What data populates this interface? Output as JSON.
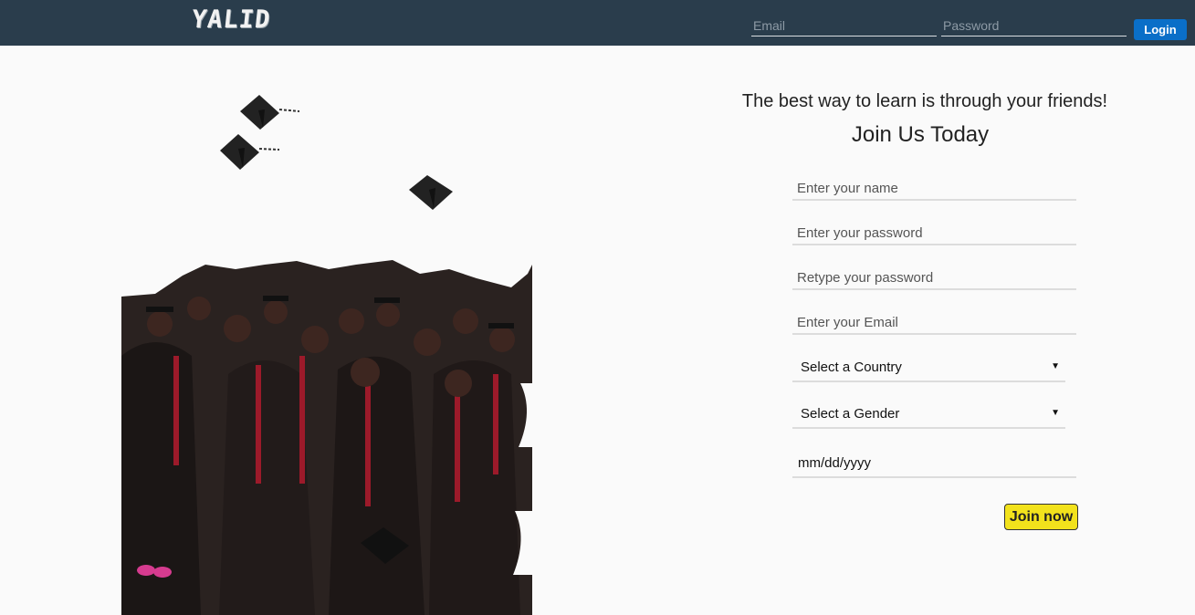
{
  "header": {
    "logo": "YALID",
    "email_placeholder": "Email",
    "password_placeholder": "Password",
    "login_label": "Login"
  },
  "signup": {
    "tagline": "The best way to learn is through your friends!",
    "heading": "Join Us Today",
    "name_placeholder": "Enter your name",
    "password_placeholder": "Enter your password",
    "retype_placeholder": "Retype your password",
    "email_placeholder": "Enter your Email",
    "country_selected": "Select a Country",
    "gender_selected": "Select a Gender",
    "date_placeholder": "mm/dd/yyyy",
    "join_label": "Join now"
  },
  "colors": {
    "header_bg": "#2a3d4c",
    "login_button": "#0a6fc8",
    "join_button": "#f2e21c",
    "page_bg": "#fafafa"
  },
  "icons": {
    "dropdown": "chevron-down-icon"
  }
}
